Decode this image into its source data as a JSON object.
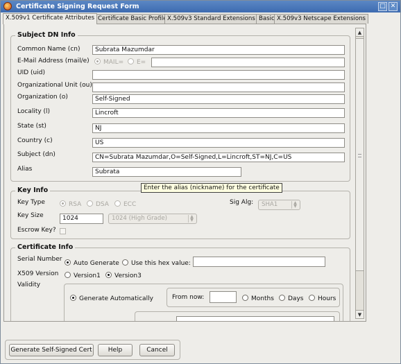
{
  "window": {
    "title": "Certificate Signing Request Form",
    "icon": "app-logo-icon"
  },
  "tabs": [
    "X.509v1 Certificate Attributes",
    "Certificate Basic Profile",
    "X.509v3 Standard Extensions",
    "Basic",
    "X.509v3 Netscape Extensions"
  ],
  "subject": {
    "legend": "Subject DN Info",
    "common_name_label": "Common Name (cn)",
    "common_name_value": "Subrata Mazumdar",
    "email_label": "E-Mail Address (mail/e)",
    "email_opt_mail": "MAIL=",
    "email_opt_e": "E=",
    "email_value": "",
    "uid_label": "UID (uid)",
    "uid_value": "",
    "ou_label": "Organizational Unit (ou)",
    "ou_value": "",
    "org_label": "Organization (o)",
    "org_value": "Self-Signed",
    "locality_label": "Locality (l)",
    "locality_value": "Lincroft",
    "state_label": "State (st)",
    "state_value": "NJ",
    "country_label": "Country (c)",
    "country_value": "US",
    "subject_label": "Subject (dn)",
    "subject_value": "CN=Subrata Mazumdar,O=Self-Signed,L=Lincroft,ST=NJ,C=US",
    "alias_label": "Alias",
    "alias_value": "Subrata"
  },
  "tooltip": "Enter the alias (nickname) for the certificate",
  "key": {
    "legend": "Key Info",
    "type_label": "Key Type",
    "type_rsa": "RSA",
    "type_dsa": "DSA",
    "type_ecc": "ECC",
    "sig_alg_label": "Sig Alg:",
    "sig_alg_value": "SHA1",
    "size_label": "Key Size",
    "size_value": "1024",
    "size_option": "1024 (High Grade)",
    "escrow_label": "Escrow Key?"
  },
  "cert": {
    "legend": "Certificate Info",
    "serial_label": "Serial Number",
    "auto_generate": "Auto Generate",
    "use_hex": "Use this hex value:",
    "hex_value": "",
    "version_label": "X509 Version",
    "version1": "Version1",
    "version3": "Version3",
    "validity_label": "Validity",
    "gen_auto": "Generate Automatically",
    "from_now": "From now:",
    "from_now_value": "",
    "months": "Months",
    "days": "Days",
    "hours": "Hours"
  },
  "footer": {
    "generate": "Generate Self-Signed Cert",
    "help": "Help",
    "cancel": "Cancel"
  }
}
